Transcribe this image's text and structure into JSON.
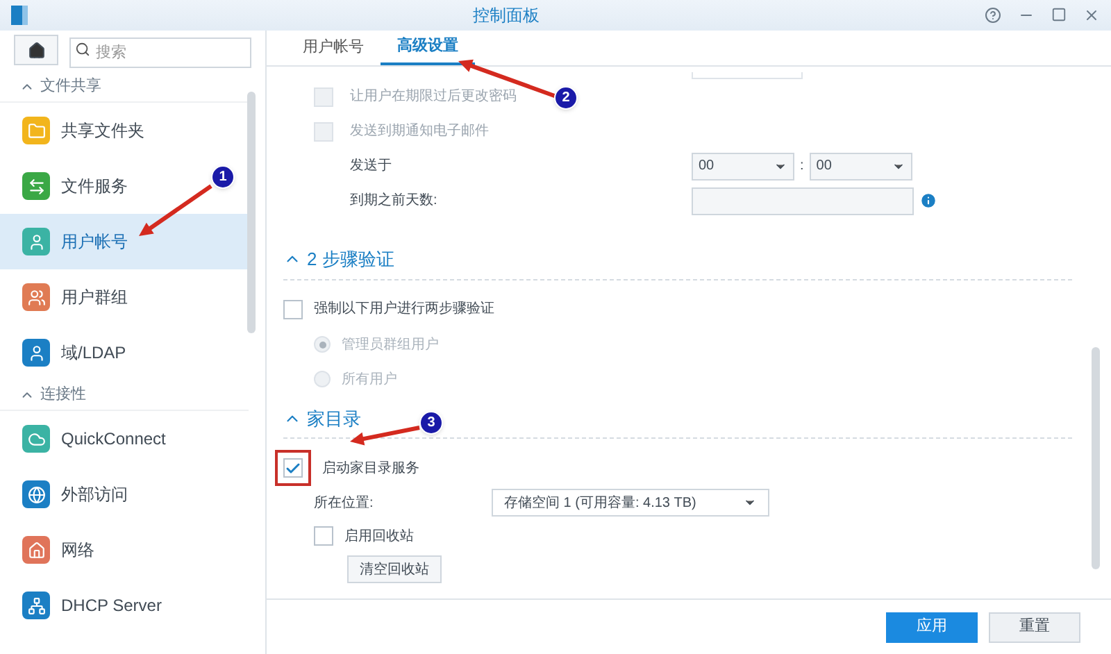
{
  "window": {
    "title": "控制面板"
  },
  "sidebar": {
    "search": {
      "placeholder": "搜索"
    },
    "groups": [
      {
        "label": "文件共享",
        "expanded": true,
        "items": [
          {
            "label": "共享文件夹",
            "selected": false
          },
          {
            "label": "文件服务",
            "selected": false
          },
          {
            "label": "用户帐号",
            "selected": true
          },
          {
            "label": "用户群组",
            "selected": false
          },
          {
            "label": "域/LDAP",
            "selected": false
          }
        ]
      },
      {
        "label": "连接性",
        "expanded": true,
        "items": [
          {
            "label": "QuickConnect",
            "selected": false
          },
          {
            "label": "外部访问",
            "selected": false
          },
          {
            "label": "网络",
            "selected": false
          },
          {
            "label": "DHCP Server",
            "selected": false
          }
        ]
      }
    ]
  },
  "tabs": [
    {
      "label": "用户帐号",
      "selected": false
    },
    {
      "label": "高级设置",
      "selected": true
    }
  ],
  "expiry": {
    "options": [
      {
        "label": "让用户在期限过后更改密码",
        "checked": false,
        "disabled": true
      },
      {
        "label": "发送到期通知电子邮件",
        "checked": false,
        "disabled": true
      }
    ],
    "send_at": {
      "label": "发送于",
      "hour": "00",
      "minute": "00",
      "separator": ":"
    },
    "days_before": {
      "label": "到期之前天数:"
    }
  },
  "two_step": {
    "title": "2 步骤验证",
    "expanded": true,
    "enforce": {
      "label": "强制以下用户进行两步骤验证",
      "checked": false
    },
    "radios": [
      {
        "label": "管理员群组用户",
        "selected": true,
        "disabled": true
      },
      {
        "label": "所有用户",
        "selected": false,
        "disabled": true
      }
    ]
  },
  "home": {
    "title": "家目录",
    "expanded": true,
    "enable": {
      "label": "启动家目录服务",
      "checked": true
    },
    "location": {
      "label": "所在位置:",
      "value": "存储空间 1 (可用容量: 4.13 TB)"
    },
    "recycle": {
      "label": "启用回收站",
      "checked": false
    },
    "empty_button": "清空回收站"
  },
  "buttons": [
    {
      "label": "应用",
      "kind": "primary"
    },
    {
      "label": "重置",
      "kind": "secondary"
    }
  ],
  "annotations": [
    {
      "number": "1"
    },
    {
      "number": "2"
    },
    {
      "number": "3"
    }
  ]
}
